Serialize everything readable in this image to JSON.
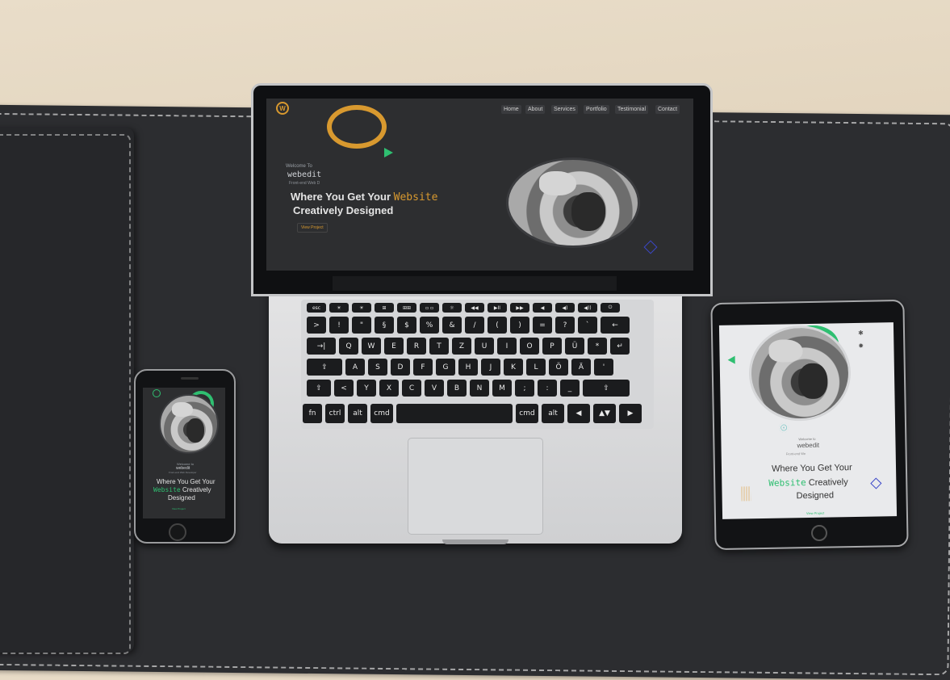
{
  "site": {
    "logo": "W",
    "nav": [
      "Home",
      "About",
      "Services",
      "Portfolio",
      "Testimonial",
      "Contact"
    ],
    "welcome": "Welcome To",
    "brand": "webedit",
    "tagline": "Front-end Web D",
    "headline_1": "Where You Get Your",
    "headline_highlight": "Website",
    "headline_2": "Creatively Designed",
    "cta": "View Project"
  },
  "phone_site": {
    "welcome": "Welcome to",
    "brand": "webedit",
    "tagline": "Front-end Web Developer",
    "headline_1": "Where You Get Your",
    "headline_highlight": "Website",
    "headline_2": "Creatively",
    "headline_3": "Designed",
    "cta": "View Project"
  },
  "tablet_site": {
    "welcome": "Welcome to",
    "brand": "webedit",
    "tagline": "Front-end We",
    "headline_1": "Where You Get Your",
    "headline_highlight": "Website",
    "headline_2": "Creatively",
    "headline_3": "Designed",
    "cta": "View Project"
  },
  "keyboard": {
    "row_fn": [
      "esc",
      "☀",
      "☀",
      "⊞",
      "⊞⊞",
      "▫ ▫",
      "☼",
      "◀◀",
      "▶II",
      "▶▶",
      "◀",
      "◀)",
      "◀))",
      "⏻"
    ],
    "row_num": [
      ">",
      "!",
      "\"",
      "§",
      "$",
      "%",
      "&",
      "/",
      "(",
      ")",
      "=",
      "?",
      "`",
      "←"
    ],
    "row_q": [
      "→|",
      "Q",
      "W",
      "E",
      "R",
      "T",
      "Z",
      "U",
      "I",
      "O",
      "P",
      "Ü",
      "*",
      "↵"
    ],
    "row_a": [
      "⇪",
      "A",
      "S",
      "D",
      "F",
      "G",
      "H",
      "J",
      "K",
      "L",
      "Ö",
      "Ä",
      "'"
    ],
    "row_y": [
      "⇧",
      "<",
      "Y",
      "X",
      "C",
      "V",
      "B",
      "N",
      "M",
      ";",
      ":",
      "_",
      "⇧"
    ],
    "row_mod": [
      "fn",
      "ctrl",
      "alt",
      "cmd",
      "",
      "cmd",
      "alt",
      "◀",
      "▲▼",
      "▶"
    ]
  },
  "colors": {
    "accent_orange": "#d8992f",
    "accent_green": "#2fbf71",
    "accent_blue": "#3b47c9",
    "screen_dark": "#2d2e30",
    "screen_light": "#e9eaec",
    "mat": "#2c2d30"
  }
}
